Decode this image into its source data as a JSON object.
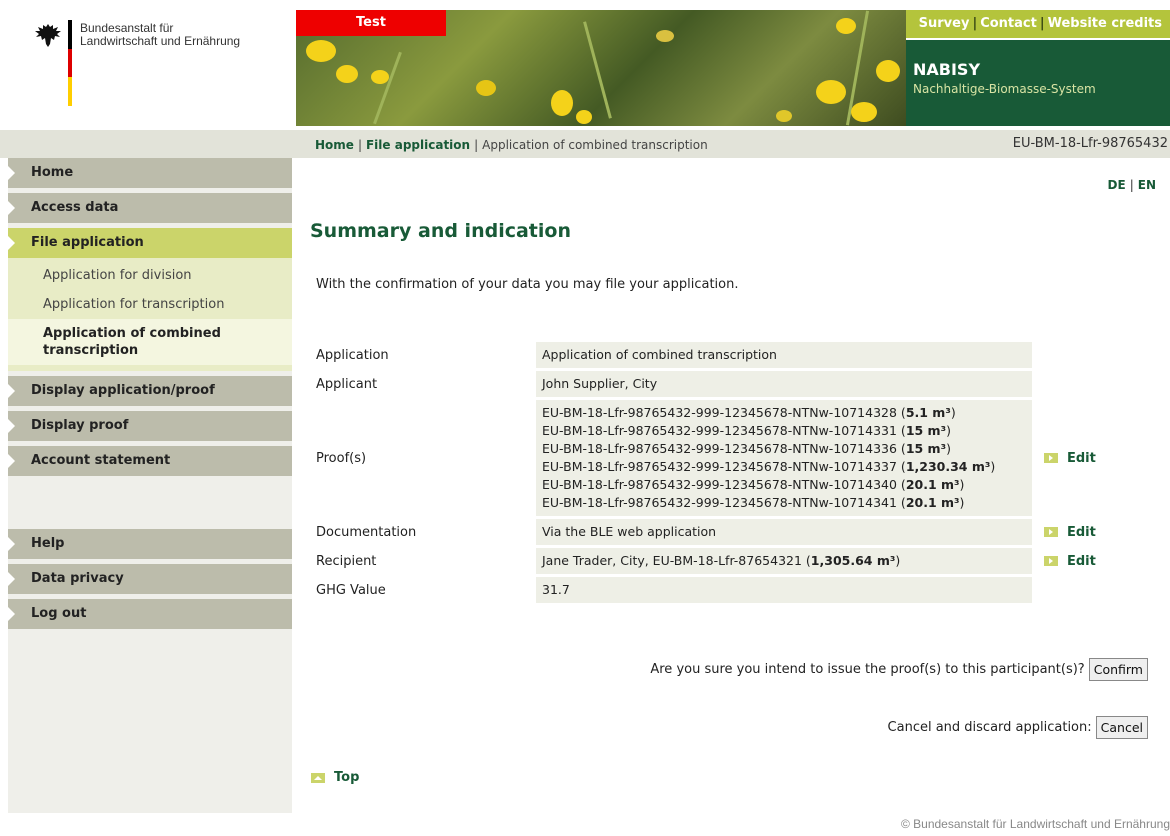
{
  "header": {
    "institution_line1": "Bundesanstalt für",
    "institution_line2": "Landwirtschaft und Ernährung",
    "test_tab": "Test",
    "toplinks": [
      "Survey",
      "Contact",
      "Website credits"
    ],
    "app_title": "NABISY",
    "app_subtitle": "Nachhaltige-Biomasse-System",
    "flag_colors": [
      "#000000",
      "#dd0000",
      "#ffce00"
    ]
  },
  "breadcrumb": {
    "home": "Home",
    "file_application": "File application",
    "current": "Application of combined transcription",
    "separator": "|"
  },
  "account_id": "EU-BM-18-Lfr-98765432",
  "sidebar": {
    "items_top": [
      {
        "label": "Home",
        "active": false
      },
      {
        "label": "Access data",
        "active": false
      },
      {
        "label": "File application",
        "active": true
      }
    ],
    "subitems": [
      {
        "label": "Application for division",
        "active": false
      },
      {
        "label": "Application for transcription",
        "active": false
      },
      {
        "label": "Application of combined transcription",
        "active": true
      }
    ],
    "items_mid": [
      {
        "label": "Display application/proof"
      },
      {
        "label": "Display proof"
      },
      {
        "label": "Account statement"
      }
    ],
    "items_bottom": [
      {
        "label": "Help"
      },
      {
        "label": "Data privacy"
      },
      {
        "label": "Log out"
      }
    ]
  },
  "language": {
    "de": "DE",
    "en": "EN",
    "separator": "|"
  },
  "main": {
    "title": "Summary and indication",
    "intro": "With the confirmation of your data you may file your application.",
    "rows": {
      "application": {
        "label": "Application",
        "value": "Application of combined transcription"
      },
      "applicant": {
        "label": "Applicant",
        "value": "John Supplier, City"
      },
      "proofs": {
        "label": "Proof(s)",
        "items": [
          {
            "id": "EU-BM-18-Lfr-98765432-999-12345678-NTNw-10714328",
            "amount": "5.1 m³"
          },
          {
            "id": "EU-BM-18-Lfr-98765432-999-12345678-NTNw-10714331",
            "amount": "15 m³"
          },
          {
            "id": "EU-BM-18-Lfr-98765432-999-12345678-NTNw-10714336",
            "amount": "15 m³"
          },
          {
            "id": "EU-BM-18-Lfr-98765432-999-12345678-NTNw-10714337",
            "amount": "1,230.34 m³"
          },
          {
            "id": "EU-BM-18-Lfr-98765432-999-12345678-NTNw-10714340",
            "amount": "20.1 m³"
          },
          {
            "id": "EU-BM-18-Lfr-98765432-999-12345678-NTNw-10714341",
            "amount": "20.1 m³"
          }
        ]
      },
      "documentation": {
        "label": "Documentation",
        "value": "Via the BLE web application"
      },
      "recipient": {
        "label": "Recipient",
        "value_prefix": "Jane Trader, City, EU-BM-18-Lfr-87654321",
        "amount": "1,305.64 m³"
      },
      "ghg": {
        "label": "GHG Value",
        "value": "31.7"
      }
    },
    "edit_label": "Edit",
    "confirm_question": "Are you sure you intend to issue the proof(s) to this participant(s)?",
    "confirm_button": "Confirm",
    "cancel_question": "Cancel and discard application:",
    "cancel_button": "Cancel",
    "top_link": "Top"
  },
  "footer": "© Bundesanstalt für Landwirtschaft und Ernährung",
  "colors": {
    "brand_green": "#185a37",
    "accent_lime": "#cbd46a",
    "test_red": "#ee0000",
    "nav_grey": "#bcbcab"
  }
}
